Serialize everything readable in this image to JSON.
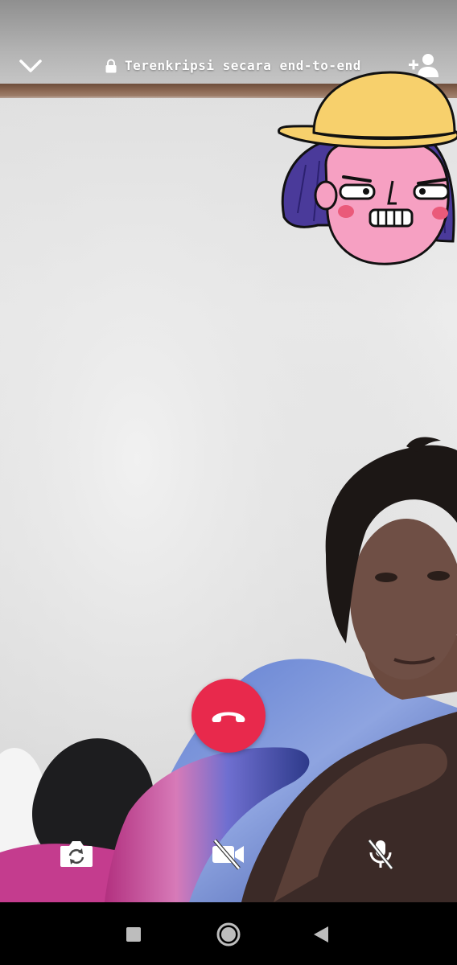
{
  "call": {
    "encryption_text": "Terenkripsi secara end-to-end"
  },
  "icons": {
    "collapse": "chevron-down-icon",
    "lock": "lock-icon",
    "add_participant": "person-add-icon",
    "end_call": "phone-hangup-icon",
    "flip_camera": "camera-flip-icon",
    "video_off": "video-off-icon",
    "mute": "mic-off-icon",
    "nav_recents": "square-icon",
    "nav_home": "circle-icon",
    "nav_back": "triangle-back-icon"
  },
  "colors": {
    "end_call": "#e8294c",
    "control_icons": "#ffffff",
    "nav_bar": "#000000"
  }
}
